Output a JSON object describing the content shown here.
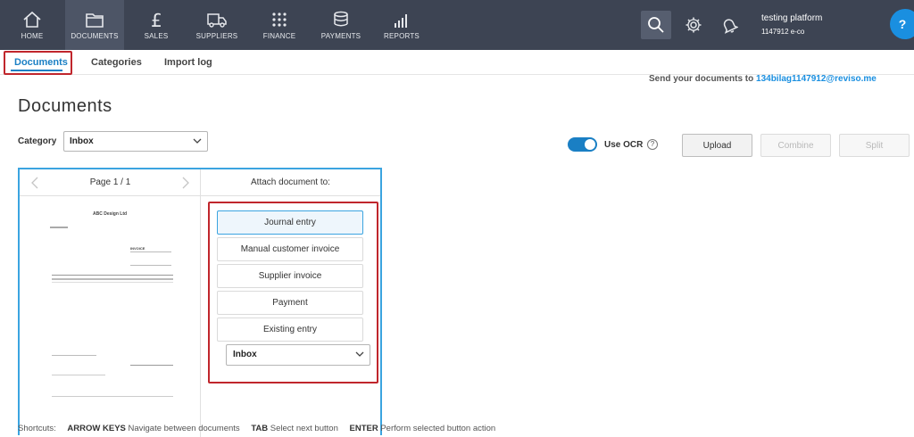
{
  "topnav": {
    "items": [
      {
        "label": "HOME",
        "icon": "home-icon"
      },
      {
        "label": "DOCUMENTS",
        "icon": "folder-icon"
      },
      {
        "label": "SALES",
        "icon": "pound-icon"
      },
      {
        "label": "SUPPLIERS",
        "icon": "truck-icon"
      },
      {
        "label": "FINANCE",
        "icon": "grid-icon"
      },
      {
        "label": "PAYMENTS",
        "icon": "coins-icon"
      },
      {
        "label": "REPORTS",
        "icon": "bar-chart-icon"
      }
    ],
    "company_name": "testing platform",
    "company_sub": "1147912 e-co",
    "help_label": "?"
  },
  "subnav": {
    "tabs": [
      {
        "label": "Documents"
      },
      {
        "label": "Categories"
      },
      {
        "label": "Import log"
      }
    ]
  },
  "send_to": {
    "prefix": "Send your documents to ",
    "email": "134bilag1147912@reviso.me"
  },
  "page_title": "Documents",
  "category": {
    "label": "Category",
    "value": "Inbox"
  },
  "ocr": {
    "label": "Use OCR",
    "info": "?",
    "enabled": true
  },
  "toolbar": {
    "upload": "Upload",
    "combine": "Combine",
    "split": "Split"
  },
  "preview": {
    "page_indicator": "Page 1 / 1",
    "doc_company": "ABC Design Ltd",
    "doc_heading": "INVOICE"
  },
  "attach": {
    "title": "Attach document to:",
    "options": [
      "Journal entry",
      "Manual customer invoice",
      "Supplier invoice",
      "Payment",
      "Existing entry"
    ],
    "selected_index": 0,
    "destination": "Inbox"
  },
  "shortcuts": {
    "label": "Shortcuts:",
    "items": [
      {
        "key": "ARROW KEYS",
        "desc": "Navigate between documents"
      },
      {
        "key": "TAB",
        "desc": "Select next button"
      },
      {
        "key": "ENTER",
        "desc": "Perform selected button action"
      }
    ]
  },
  "colors": {
    "nav_bg": "#3d4453",
    "accent": "#1a7fc4",
    "highlight": "#c0262c",
    "panel_border": "#3ba4e0"
  }
}
